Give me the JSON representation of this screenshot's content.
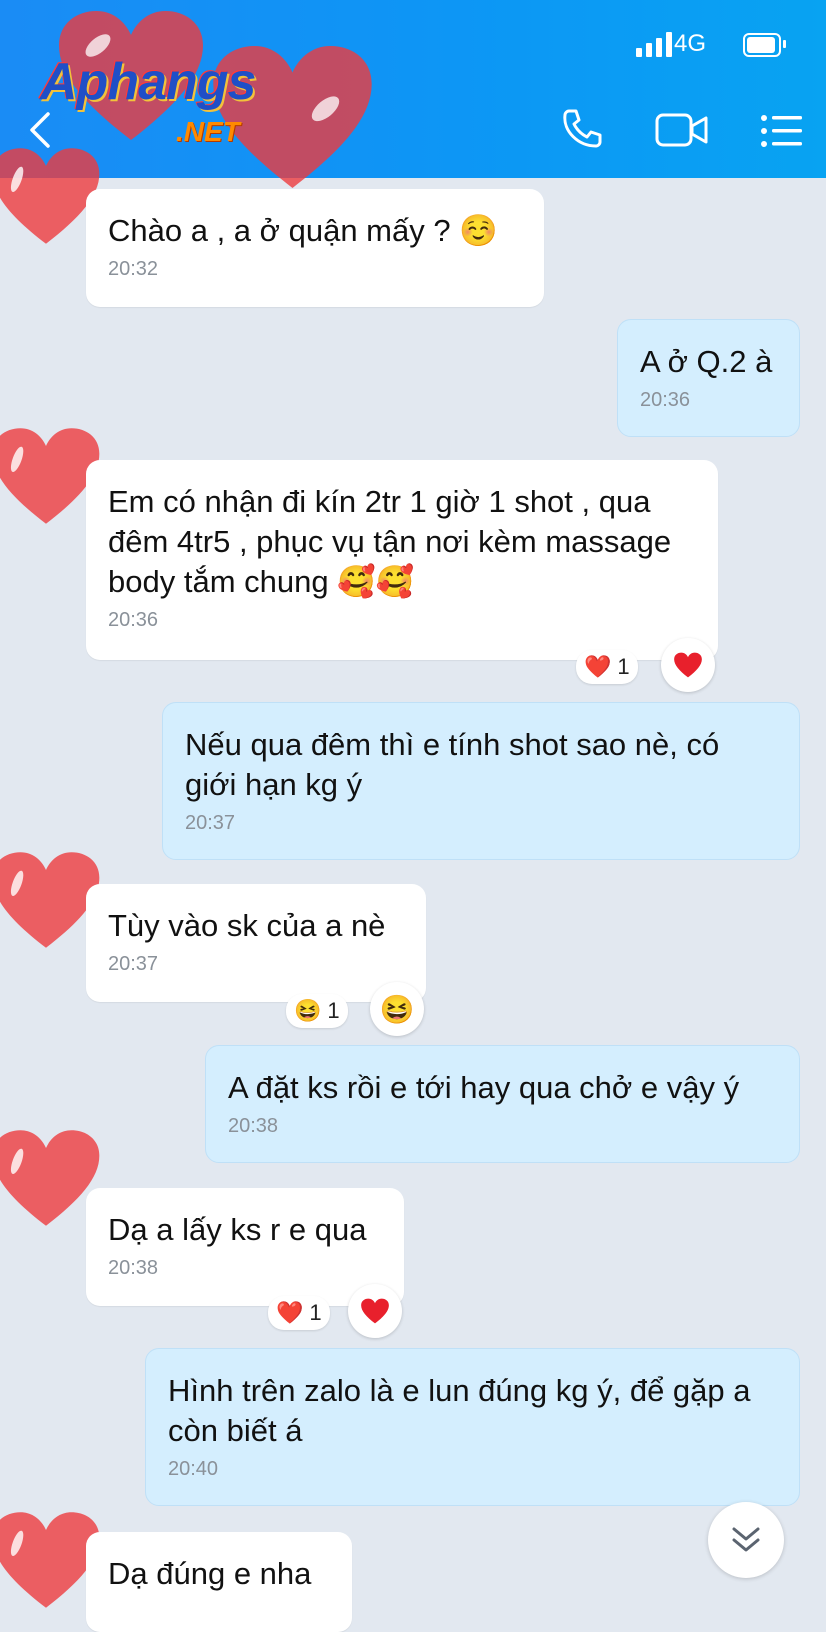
{
  "status_bar": {
    "network": "4G"
  },
  "logo": {
    "main": "Aphangs",
    "sub": ".NET"
  },
  "header_icons": [
    "back-icon",
    "phone-icon",
    "video-call-icon",
    "menu-icon"
  ],
  "colors": {
    "header": "#0d96f5",
    "incoming": "#ffffff",
    "outgoing": "#d4eefe",
    "background": "#e2e8f0"
  },
  "messages": [
    {
      "dir": "in",
      "text": "Chào a , a ở quận mấy ? ☺️",
      "time": "20:32"
    },
    {
      "dir": "out",
      "text": "A ở Q.2 à",
      "time": "20:36"
    },
    {
      "dir": "in",
      "text": "Em có nhận đi kín 2tr 1 giờ 1 shot , qua đêm 4tr5 , phục vụ tận nơi kèm massage body tắm chung 🥰🥰",
      "time": "20:36",
      "reaction": {
        "emoji": "❤️",
        "count": "1"
      }
    },
    {
      "dir": "out",
      "text": "Nếu qua đêm thì e tính shot sao nè, có giới hạn kg ý",
      "time": "20:37"
    },
    {
      "dir": "in",
      "text": "Tùy vào sk của a nè",
      "time": "20:37",
      "reaction": {
        "emoji": "😆",
        "count": "1"
      }
    },
    {
      "dir": "out",
      "text": "A đặt ks rồi e tới hay qua chở e vậy ý",
      "time": "20:38"
    },
    {
      "dir": "in",
      "text": "Dạ a lấy ks r e qua",
      "time": "20:38",
      "reaction": {
        "emoji": "❤️",
        "count": "1"
      }
    },
    {
      "dir": "out",
      "text": "Hình trên zalo là e lun đúng kg ý, để gặp a còn biết á",
      "time": "20:40"
    },
    {
      "dir": "in",
      "text": "Dạ đúng e nha",
      "time": ""
    }
  ]
}
